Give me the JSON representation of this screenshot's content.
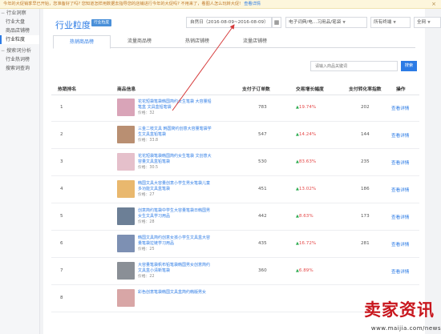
{
  "banner": {
    "text": "今年的大促销季早已开始，您准备好了吗? 您知道怎样用数据去指导您的店铺进行今年的大促吗? 不用来了，看图人怎么玩转大促!",
    "link": "查看详情",
    "close": "×"
  },
  "sidebar": {
    "group1": "行业洞察",
    "items1": [
      "行业大盘",
      "商品店铺榜",
      "行业粒度"
    ],
    "group2": "搜索词分析",
    "items2": [
      "行业热词榜",
      "搜索词查询"
    ]
  },
  "header": {
    "title": "行业粒度",
    "badge": "行业粒度",
    "date_range": "自然日（2016-08-09~2016-08-09）",
    "calendar_icon": "calendar-icon",
    "category": "电子词典/电…习用品/笔袋",
    "terminal": "所有终端",
    "network": "全网"
  },
  "tabs": [
    "热销商品榜",
    "流量商品榜",
    "热销店铺榜",
    "流量店铺榜"
  ],
  "search": {
    "placeholder": "请输入商品关键词",
    "button": "搜索"
  },
  "table": {
    "headers": [
      "热销排名",
      "商品信息",
      "支付子订单数",
      "交易增长幅度",
      "支付转化率指数",
      "操作"
    ],
    "rows": [
      {
        "rank": "1",
        "title": "花花短袋笔袋韩国简约女生笔袋 大容量铅笔盒 文具盒铅笔袋",
        "price": "价格：32",
        "orders": "783",
        "growth": "19.74%",
        "dir": "up",
        "conv": "202",
        "action": "查看详情",
        "thumb": "#d9a4b8"
      },
      {
        "rank": "2",
        "title": "三金二枝文具 韩国简约创意大容量笔袋学生文具盒铅笔袋",
        "price": "价格：33.8",
        "orders": "547",
        "growth": "14.24%",
        "dir": "up",
        "conv": "144",
        "action": "查看详情",
        "thumb": "#b98f72"
      },
      {
        "rank": "3",
        "title": "花花短袋笔袋韩国简约女生笔袋 文创意大容量文具盒铅笔袋",
        "price": "价格：30.5",
        "orders": "530",
        "growth": "83.63%",
        "dir": "up",
        "conv": "235",
        "action": "查看详情",
        "thumb": "#e5c0cb"
      },
      {
        "rank": "4",
        "title": "韩国文具大容量创意小学生男女笔袋儿童多功能文具盒笔袋",
        "price": "价格：27",
        "orders": "451",
        "growth": "13.02%",
        "dir": "up",
        "conv": "186",
        "action": "查看详情",
        "thumb": "#e9b86e"
      },
      {
        "rank": "5",
        "title": "创意简约笔袋中学生大容量笔袋日韩国男女生文具学习用品",
        "price": "价格：28",
        "orders": "442",
        "growth": "8.63%",
        "dir": "up",
        "conv": "173",
        "action": "查看详情",
        "thumb": "#6c7f96"
      },
      {
        "rank": "6",
        "title": "韩国文具简约创意女孩小学生文具盒大容量笔袋拉链学习用品",
        "price": "价格：25",
        "orders": "435",
        "growth": "16.72%",
        "dir": "up",
        "conv": "281",
        "action": "查看详情",
        "thumb": "#7d90b3"
      },
      {
        "rank": "7",
        "title": "大容量笔袋帆布铅笔袋韩国男女创意简约文具盒小清新笔袋",
        "price": "价格：22",
        "orders": "360",
        "growth": "6.89%",
        "dir": "up",
        "conv": "",
        "action": "查看详情",
        "thumb": "#8a8f96"
      },
      {
        "rank": "8",
        "title": "彩色创意笔袋韩国文具盒简约韩版男女",
        "price": "",
        "orders": "",
        "growth": "",
        "dir": "up",
        "conv": "",
        "action": "",
        "thumb": "#d8a6a6"
      }
    ]
  },
  "watermark": {
    "brand": "卖家资讯",
    "url": "www.maijia.com/news"
  },
  "colors": {
    "accent": "#2c7be5",
    "up": "#2bab4f",
    "growth_text": "#e54b4b",
    "annotation": "#d63b3b"
  }
}
